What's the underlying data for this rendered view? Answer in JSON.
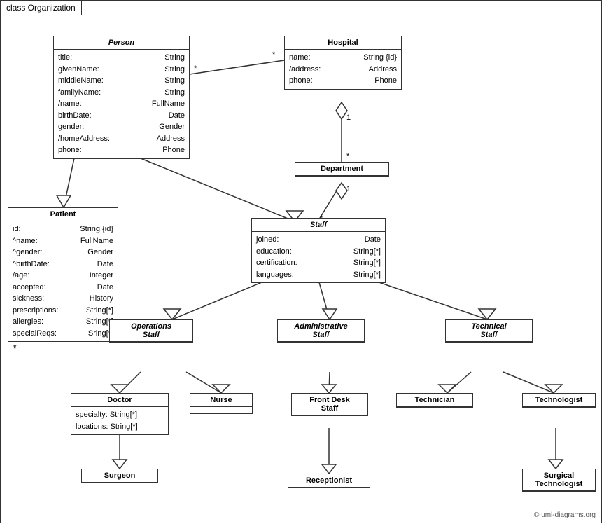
{
  "title": "class Organization",
  "classes": {
    "person": {
      "name": "Person",
      "italic": true,
      "attrs": [
        {
          "name": "title:",
          "type": "String"
        },
        {
          "name": "givenName:",
          "type": "String"
        },
        {
          "name": "middleName:",
          "type": "String"
        },
        {
          "name": "familyName:",
          "type": "String"
        },
        {
          "name": "/name:",
          "type": "FullName"
        },
        {
          "name": "birthDate:",
          "type": "Date"
        },
        {
          "name": "gender:",
          "type": "Gender"
        },
        {
          "name": "/homeAddress:",
          "type": "Address"
        },
        {
          "name": "phone:",
          "type": "Phone"
        }
      ]
    },
    "hospital": {
      "name": "Hospital",
      "italic": false,
      "attrs": [
        {
          "name": "name:",
          "type": "String {id}"
        },
        {
          "name": "/address:",
          "type": "Address"
        },
        {
          "name": "phone:",
          "type": "Phone"
        }
      ]
    },
    "patient": {
      "name": "Patient",
      "italic": false,
      "attrs": [
        {
          "name": "id:",
          "type": "String {id}"
        },
        {
          "name": "^name:",
          "type": "FullName"
        },
        {
          "name": "^gender:",
          "type": "Gender"
        },
        {
          "name": "^birthDate:",
          "type": "Date"
        },
        {
          "name": "/age:",
          "type": "Integer"
        },
        {
          "name": "accepted:",
          "type": "Date"
        },
        {
          "name": "sickness:",
          "type": "History"
        },
        {
          "name": "prescriptions:",
          "type": "String[*]"
        },
        {
          "name": "allergies:",
          "type": "String[*]"
        },
        {
          "name": "specialReqs:",
          "type": "Sring[*]"
        }
      ]
    },
    "department": {
      "name": "Department",
      "italic": false,
      "attrs": []
    },
    "staff": {
      "name": "Staff",
      "italic": true,
      "attrs": [
        {
          "name": "joined:",
          "type": "Date"
        },
        {
          "name": "education:",
          "type": "String[*]"
        },
        {
          "name": "certification:",
          "type": "String[*]"
        },
        {
          "name": "languages:",
          "type": "String[*]"
        }
      ]
    },
    "operations_staff": {
      "name": "Operations Staff",
      "italic": true,
      "attrs": []
    },
    "admin_staff": {
      "name": "Administrative Staff",
      "italic": true,
      "attrs": []
    },
    "technical_staff": {
      "name": "Technical Staff",
      "italic": true,
      "attrs": []
    },
    "doctor": {
      "name": "Doctor",
      "italic": false,
      "attrs": [
        {
          "name": "specialty:",
          "type": "String[*]"
        },
        {
          "name": "locations:",
          "type": "String[*]"
        }
      ]
    },
    "nurse": {
      "name": "Nurse",
      "italic": false,
      "attrs": []
    },
    "front_desk": {
      "name": "Front Desk Staff",
      "italic": false,
      "attrs": []
    },
    "technician": {
      "name": "Technician",
      "italic": false,
      "attrs": []
    },
    "technologist": {
      "name": "Technologist",
      "italic": false,
      "attrs": []
    },
    "surgeon": {
      "name": "Surgeon",
      "italic": false,
      "attrs": []
    },
    "receptionist": {
      "name": "Receptionist",
      "italic": false,
      "attrs": []
    },
    "surgical_technologist": {
      "name": "Surgical Technologist",
      "italic": false,
      "attrs": []
    }
  },
  "copyright": "© uml-diagrams.org"
}
